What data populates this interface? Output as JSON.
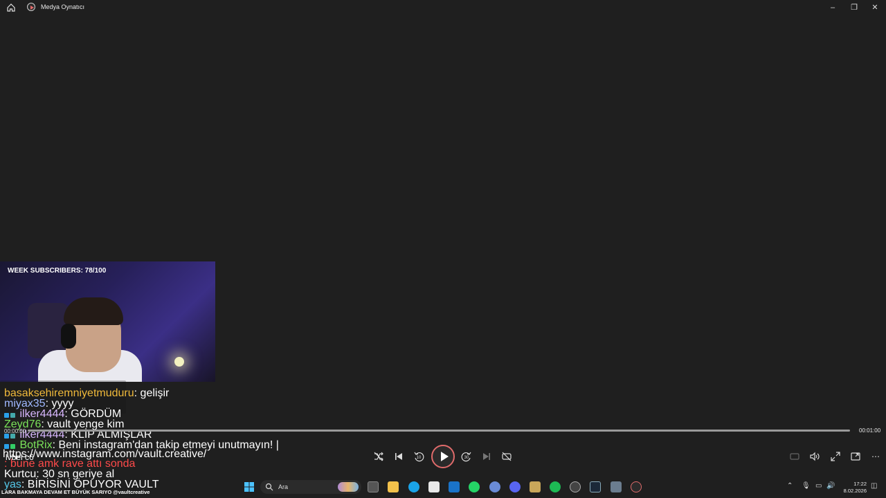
{
  "window": {
    "title": "Medya Oynatıcı"
  },
  "stream": {
    "overlay_title": "WEEK SUBSCRIBERS: 78/100"
  },
  "chat": [
    {
      "user": "basaksehiremniyetmuduru",
      "message": ": gelişir",
      "user_color": "#f0b93a",
      "badges": 0
    },
    {
      "user": "miyax35",
      "message": ": yyyy",
      "user_color": "#9fb8ff",
      "badges": 0
    },
    {
      "user": "ilker4444",
      "message": ": GÖRDÜM",
      "user_color": "#d9b8ff",
      "badges": 3
    },
    {
      "user": "Zeyd76",
      "message": ": vault yenge kim",
      "user_color": "#7be35a",
      "badges": 0
    },
    {
      "user": "ilker4444",
      "message": ": KLİP ALMIŞLAR",
      "user_color": "#d9b8ff",
      "badges": 3
    },
    {
      "user": "BotRix",
      "message": ": Beni instagram'dan takip etmeyi unutmayın! |",
      "user_color": "#7be35a",
      "badges": 2
    },
    {
      "user": "",
      "message": "https://www.instagram.com/vault.creative/",
      "user_color": "#ffffff",
      "badges": 0
    },
    {
      "user": "",
      "message": ": bune amk rave attı sonda",
      "user_color": "#ff4a4a",
      "badges": 0
    },
    {
      "user": "Kurtcu",
      "message": ": 30 sn geriye al",
      "user_color": "#ffffff",
      "badges": 0
    },
    {
      "user": "yas",
      "message": ": BİRİSİNİ ÖPUYOR VAULT",
      "user_color": "#54c7e8",
      "badges": 0
    }
  ],
  "overlay_caption": "lvbel c6",
  "ticker": "LARA BAKMAYA DEVAM ET BÜYÜK SARIYO @vaultcreative",
  "player": {
    "current_time": "00:00:00",
    "total_time": "00:01:00",
    "progress": 0
  },
  "taskbar": {
    "search_placeholder": "Ara",
    "time": "17:22",
    "date": "8.02.2026"
  }
}
